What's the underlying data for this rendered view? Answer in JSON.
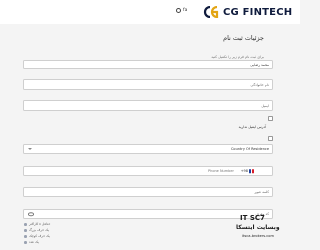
{
  "header": {
    "language": "fa",
    "logo_text": "CG FINTECH"
  },
  "form": {
    "title": "جزئیات ثبت نام",
    "subtitle": "برای ثبت نام فرم زیر را تکمیل کنید",
    "full_name_value": "محمد رضایی",
    "last_name_placeholder": "نام خانوادگی",
    "email_placeholder": "ایمیل",
    "checkbox_label": "آدرس ایمیل ندارید",
    "country_value": "Country Of Residence",
    "phone_prefix": "+98",
    "phone_placeholder": "Phone Number",
    "password_placeholder": "کلمه عبور",
    "referral_placeholder": "کد معرف"
  },
  "password_hints": [
    "حداقل ۸ کاراکتر",
    "یک حرف بزرگ",
    "یک حرف کوچک",
    "یک عدد"
  ],
  "watermark": {
    "logo": "IT SC7",
    "title": "وبسایت ایتسکا",
    "url": "itsca-brokers.com"
  },
  "colors": {
    "brand_navy": "#0f1b3d",
    "brand_gold": "#e3a514",
    "flag_blue": "#1a3fa0",
    "flag_red": "#d81e2a"
  }
}
